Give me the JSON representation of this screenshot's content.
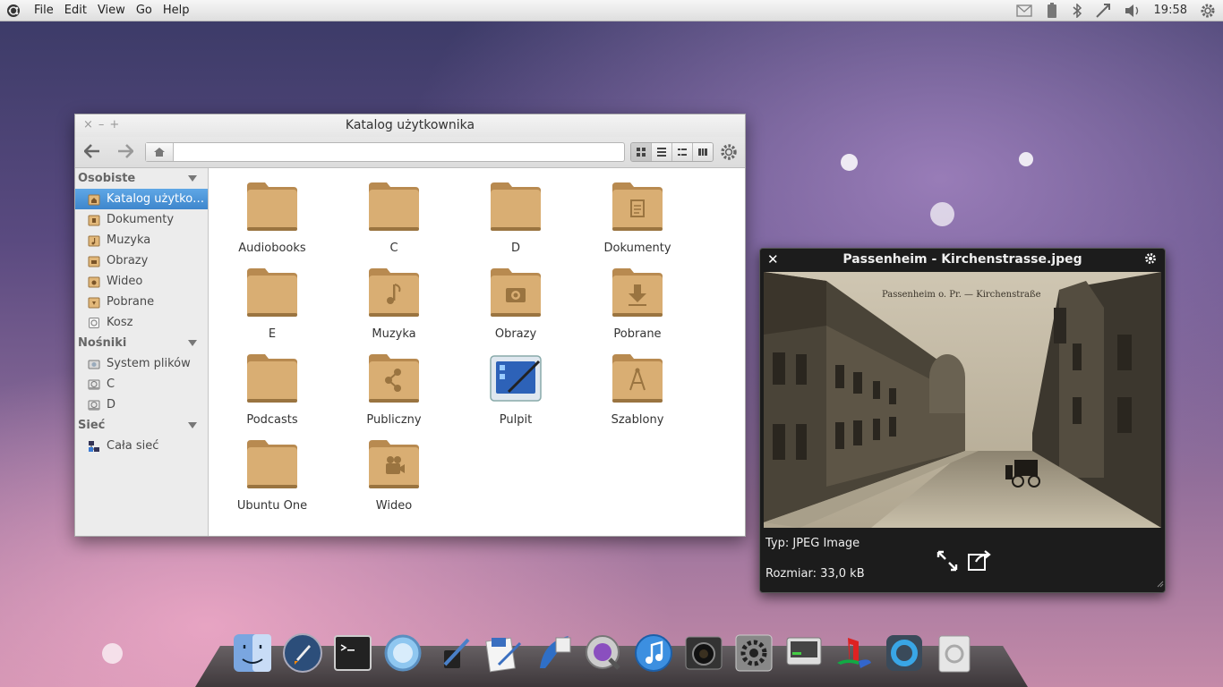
{
  "panel": {
    "menus": [
      "File",
      "Edit",
      "View",
      "Go",
      "Help"
    ],
    "clock": "19:58"
  },
  "file_manager": {
    "title": "Katalog użytkownika",
    "sidebar": {
      "sections": [
        {
          "title": "Osobiste",
          "items": [
            "Katalog użytko…",
            "Dokumenty",
            "Muzyka",
            "Obrazy",
            "Wideo",
            "Pobrane",
            "Kosz"
          ]
        },
        {
          "title": "Nośniki",
          "items": [
            "System plików",
            "C",
            "D"
          ]
        },
        {
          "title": "Sieć",
          "items": [
            "Cała sieć"
          ]
        }
      ],
      "selected": "Katalog użytko…"
    },
    "items": [
      {
        "label": "Audiobooks",
        "icon": "folder-icon"
      },
      {
        "label": "C",
        "icon": "folder-icon"
      },
      {
        "label": "D",
        "icon": "folder-icon"
      },
      {
        "label": "Dokumenty",
        "icon": "folder-documents-icon"
      },
      {
        "label": "E",
        "icon": "folder-icon"
      },
      {
        "label": "Muzyka",
        "icon": "folder-music-icon"
      },
      {
        "label": "Obrazy",
        "icon": "folder-pictures-icon"
      },
      {
        "label": "Pobrane",
        "icon": "folder-download-icon"
      },
      {
        "label": "Podcasts",
        "icon": "folder-icon"
      },
      {
        "label": "Publiczny",
        "icon": "folder-publicshare-icon"
      },
      {
        "label": "Pulpit",
        "icon": "desktop-icon"
      },
      {
        "label": "Szablony",
        "icon": "folder-templates-icon"
      },
      {
        "label": "Ubuntu One",
        "icon": "folder-icon"
      },
      {
        "label": "Wideo",
        "icon": "folder-video-icon"
      }
    ]
  },
  "preview": {
    "title": "Passenheim - Kirchenstrasse.jpeg",
    "photo_caption": "Passenheim o. Pr. — Kirchenstraße",
    "type_text": "Typ: JPEG Image",
    "size_text": "Rozmiar: 33,0 kB"
  },
  "dock": {
    "apps": [
      "finder-icon",
      "rocket-icon",
      "terminal-icon",
      "browser-icon",
      "ink-icon",
      "text-editor-icon",
      "photoshop-icon",
      "quicktime-icon",
      "itunes-icon",
      "camera-icon",
      "system-preferences-icon",
      "monitor-icon",
      "playstation-icon",
      "sync-icon",
      "trash-icon"
    ]
  },
  "colors": {
    "folder": "#d9ae73",
    "selection": "#4a90d9",
    "panel": "#e8e8e8"
  }
}
